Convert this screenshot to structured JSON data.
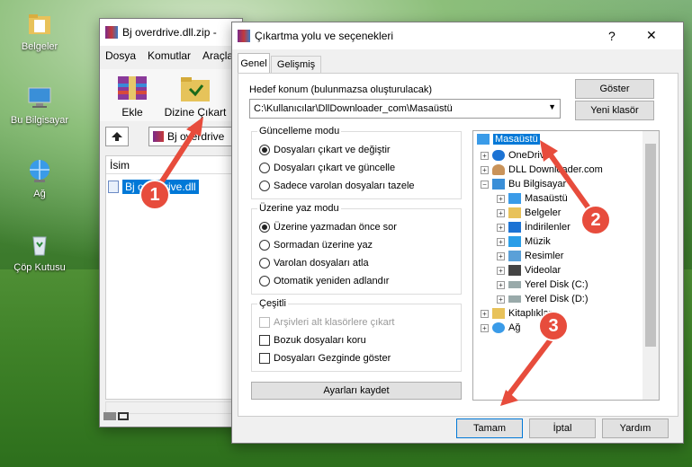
{
  "desktop": {
    "icons": [
      {
        "label": "Belgeler"
      },
      {
        "label": "Bu Bilgisayar"
      },
      {
        "label": "Ağ"
      },
      {
        "label": "Çöp Kutusu"
      }
    ]
  },
  "winrar": {
    "title": "Bj overdrive.dll.zip -",
    "menu": [
      "Dosya",
      "Komutlar",
      "Araçlar"
    ],
    "toolbar": {
      "add": "Ekle",
      "extract": "Dizine Çıkart"
    },
    "path": "Bj overdrive",
    "column_name": "İsim",
    "file": "Bj overdrive.dll"
  },
  "dialog": {
    "title": "Çıkartma yolu ve seçenekleri",
    "tabs": [
      "Genel",
      "Gelişmiş"
    ],
    "target_label": "Hedef konum (bulunmazsa oluşturulacak)",
    "target_value": "C:\\Kullanıcılar\\DllDownloader_com\\Masaüstü",
    "show_button": "Göster",
    "new_folder_button": "Yeni klasör",
    "update_group": {
      "title": "Güncelleme modu",
      "options": [
        "Dosyaları çıkart ve değiştir",
        "Dosyaları çıkart ve güncelle",
        "Sadece varolan dosyaları tazele"
      ],
      "selected": 0
    },
    "overwrite_group": {
      "title": "Üzerine yaz modu",
      "options": [
        "Üzerine yazmadan önce sor",
        "Sormadan üzerine yaz",
        "Varolan dosyaları atla",
        "Otomatik yeniden adlandır"
      ],
      "selected": 0
    },
    "misc_group": {
      "title": "Çeşitli",
      "options": [
        "Arşivleri alt klasörlere çıkart",
        "Bozuk dosyaları koru",
        "Dosyaları Gezginde göster"
      ]
    },
    "save_settings": "Ayarları kaydet",
    "tree": {
      "root": "Masaüstü",
      "items": [
        "OneDrive",
        "DLL Downloader.com",
        "Bu Bilgisayar",
        "Masaüstü",
        "Belgeler",
        "İndirilenler",
        "Müzik",
        "Resimler",
        "Videolar",
        "Yerel Disk (C:)",
        "Yerel Disk (D:)",
        "Kitaplıklar",
        "Ağ"
      ]
    },
    "ok": "Tamam",
    "cancel": "İptal",
    "help": "Yardım",
    "help_glyph": "?",
    "close_glyph": "✕"
  },
  "callouts": [
    "1",
    "2",
    "3"
  ],
  "colors": {
    "arrow": "#e74c3c",
    "selection": "#0078d7"
  }
}
